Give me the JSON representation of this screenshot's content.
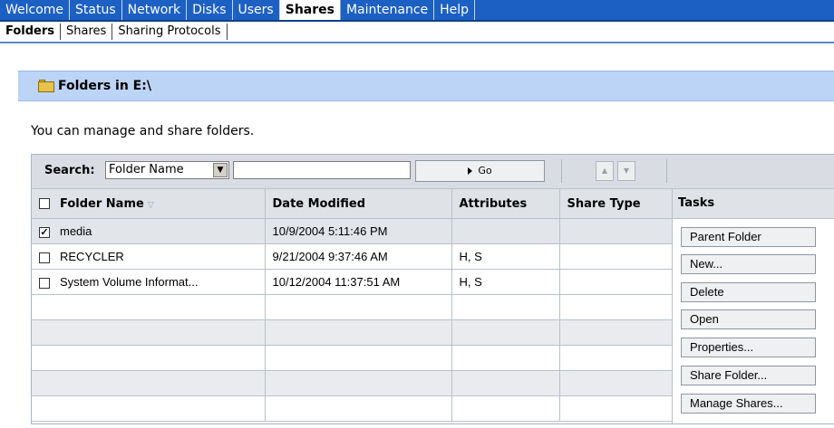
{
  "top_nav": {
    "tabs": [
      {
        "label": "Welcome",
        "active": false
      },
      {
        "label": "Status",
        "active": false
      },
      {
        "label": "Network",
        "active": false
      },
      {
        "label": "Disks",
        "active": false
      },
      {
        "label": "Users",
        "active": false
      },
      {
        "label": "Shares",
        "active": true
      },
      {
        "label": "Maintenance",
        "active": false
      },
      {
        "label": "Help",
        "active": false
      }
    ]
  },
  "sub_nav": {
    "tabs": [
      {
        "label": "Folders",
        "active": true
      },
      {
        "label": "Shares",
        "active": false
      },
      {
        "label": "Sharing Protocols",
        "active": false
      }
    ]
  },
  "header": {
    "title": "Folders in E:\\",
    "icon": "folder-icon"
  },
  "intro_text": "You can manage and share folders.",
  "search": {
    "label": "Search:",
    "field_selected": "Folder Name",
    "value": "",
    "go_label": "Go"
  },
  "table": {
    "columns": [
      "Folder Name",
      "Date Modified",
      "Attributes",
      "Share Type"
    ],
    "rows": [
      {
        "checked": true,
        "name": "media",
        "date": "10/9/2004 5:11:46 PM",
        "attributes": "",
        "share_type": ""
      },
      {
        "checked": false,
        "name": "RECYCLER",
        "date": "9/21/2004 9:37:46 AM",
        "attributes": "H, S",
        "share_type": ""
      },
      {
        "checked": false,
        "name": "System Volume Informat...",
        "date": "10/12/2004 11:37:51 AM",
        "attributes": "H, S",
        "share_type": ""
      }
    ]
  },
  "tasks": {
    "title": "Tasks",
    "buttons": [
      "Parent Folder",
      "New...",
      "Delete",
      "Open",
      "Properties...",
      "Share Folder...",
      "Manage Shares..."
    ]
  },
  "colors": {
    "nav_bar": "#1c60c4",
    "header_bar": "#bcd4f6"
  }
}
